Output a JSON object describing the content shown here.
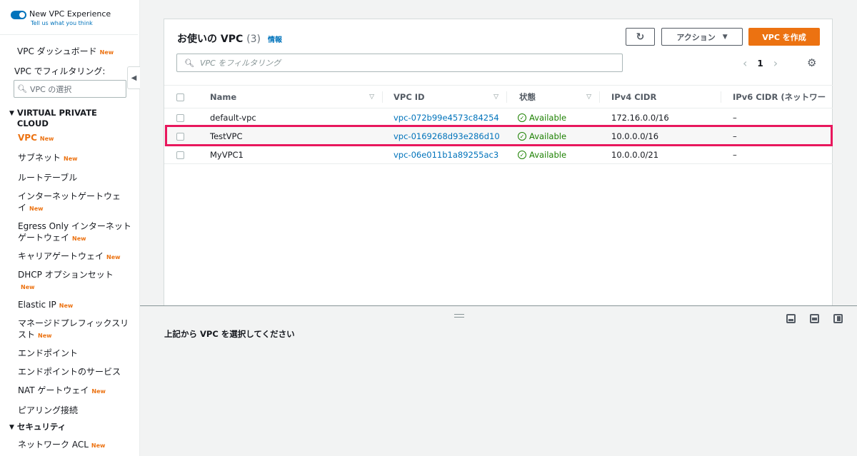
{
  "sidebar": {
    "toggle_title": "New VPC Experience",
    "toggle_sub": "Tell us what you think",
    "dashboard": "VPC ダッシュボード",
    "new_badge": "New",
    "filter_label": "VPC でフィルタリング:",
    "vpc_select_placeholder": "VPC の選択",
    "section_vpc": "VIRTUAL PRIVATE CLOUD",
    "items": [
      {
        "label": "VPC",
        "new": "New"
      },
      {
        "label": "サブネット",
        "new": "New"
      },
      {
        "label": "ルートテーブル",
        "new": ""
      },
      {
        "label": "インターネットゲートウェイ",
        "new": "New"
      },
      {
        "label": "Egress Only インターネットゲートウェイ",
        "new": "New"
      },
      {
        "label": "キャリアゲートウェイ",
        "new": "New"
      },
      {
        "label": "DHCP オプションセット",
        "new": "New"
      },
      {
        "label": "Elastic IP",
        "new": "New"
      },
      {
        "label": "マネージドプレフィックスリスト",
        "new": "New"
      },
      {
        "label": "エンドポイント",
        "new": ""
      },
      {
        "label": "エンドポイントのサービス",
        "new": ""
      },
      {
        "label": "NAT ゲートウェイ",
        "new": "New"
      },
      {
        "label": "ピアリング接続",
        "new": ""
      }
    ],
    "section_security": "セキュリティ",
    "security_items": [
      {
        "label": "ネットワーク ACL",
        "new": "New"
      }
    ]
  },
  "header": {
    "title": "お使いの VPC",
    "count": "(3)",
    "info": "情報",
    "refresh_icon": "refresh-icon",
    "action_label": "アクション",
    "create_label": "VPC を作成",
    "search_placeholder": "VPC をフィルタリング",
    "page": "1"
  },
  "table": {
    "columns": [
      "Name",
      "VPC ID",
      "状態",
      "IPv4 CIDR",
      "IPv6 CIDR (ネットワー"
    ],
    "rows": [
      {
        "name": "default-vpc",
        "vpc_id": "vpc-072b99e4573c84254",
        "status": "Available",
        "ipv4": "172.16.0.0/16",
        "ipv6": "–"
      },
      {
        "name": "TestVPC",
        "vpc_id": "vpc-0169268d93e286d10",
        "status": "Available",
        "ipv4": "10.0.0.0/16",
        "ipv6": "–"
      },
      {
        "name": "MyVPC1",
        "vpc_id": "vpc-06e011b1a89255ac3",
        "status": "Available",
        "ipv4": "10.0.0.0/21",
        "ipv6": "–"
      }
    ]
  },
  "bottom": {
    "message": "上記から VPC を選択してください"
  },
  "colors": {
    "accent": "#ec7211",
    "link": "#0073bb",
    "success": "#1d8102",
    "highlight": "#e8175d"
  }
}
